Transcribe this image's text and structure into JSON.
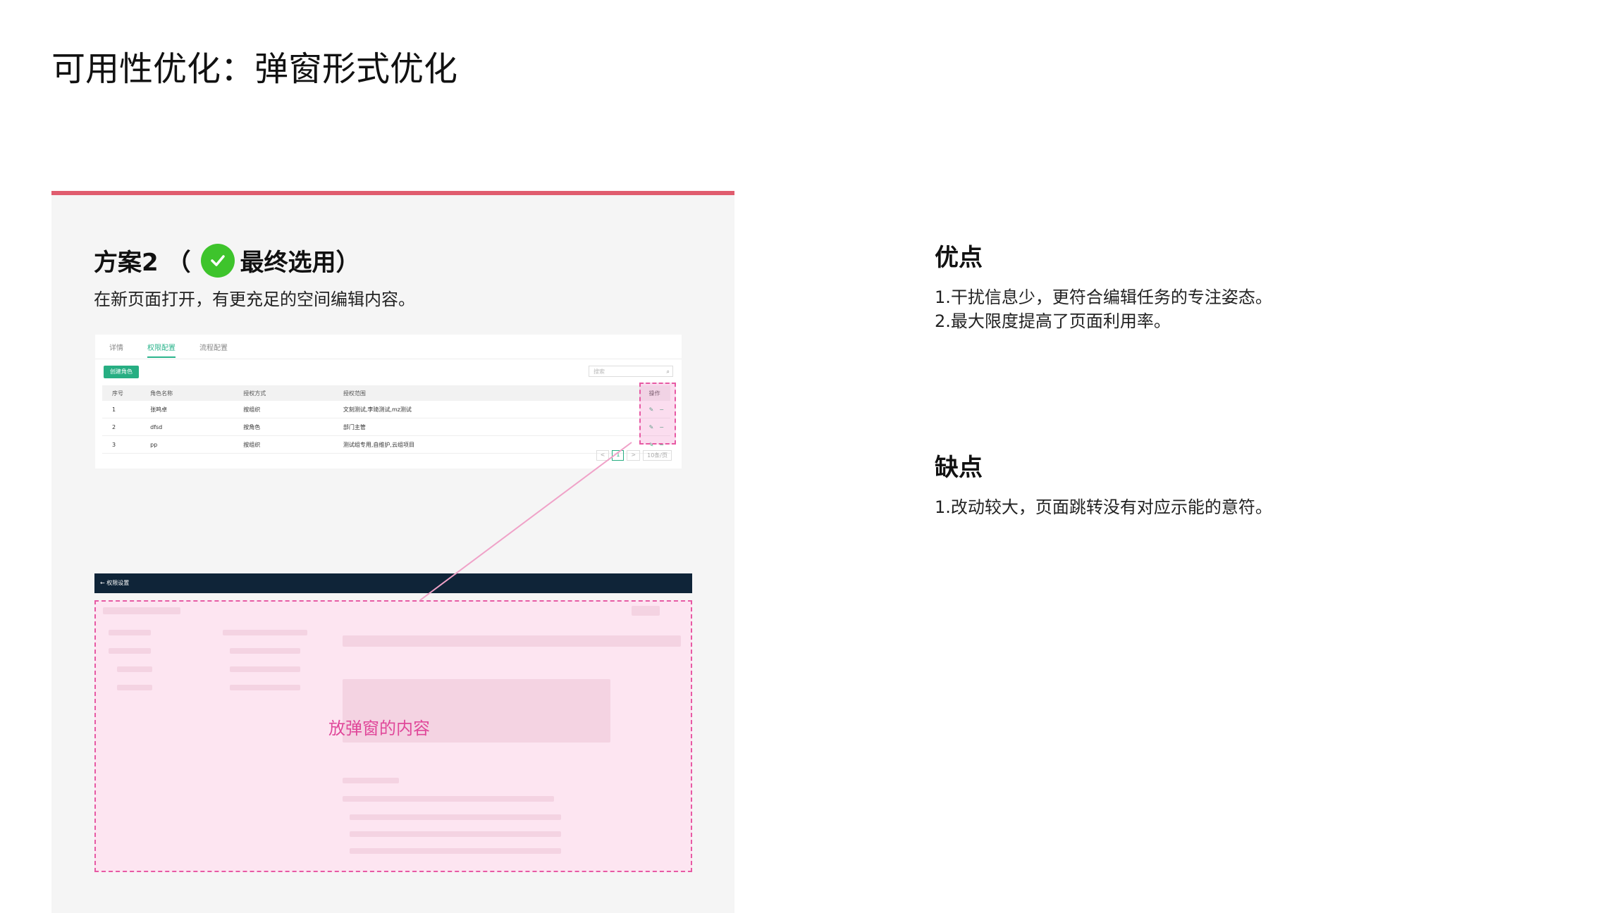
{
  "page": {
    "title": "可用性优化：弹窗形式优化"
  },
  "card": {
    "title_prefix": "方案2 （",
    "title_suffix": "最终选用）",
    "description": "在新页面打开，有更充足的空间编辑内容。",
    "accent_color": "#e05c6e",
    "check_color": "#3ec42c"
  },
  "screenshot1": {
    "tabs": [
      "详情",
      "权限配置",
      "流程配置"
    ],
    "active_tab": 1,
    "create_button": "创建角色",
    "search_placeholder": "搜索",
    "columns": [
      "序号",
      "角色名称",
      "授权方式",
      "授权范围",
      "操作"
    ],
    "rows": [
      [
        "1",
        "张鸣卓",
        "按组织",
        "文刻测试,李琦测试,mz测试"
      ],
      [
        "2",
        "dfsd",
        "按角色",
        "部门主管"
      ],
      [
        "3",
        "pp",
        "按组织",
        "测试组专用,自维护,云组项目"
      ]
    ],
    "pager": [
      "<",
      "1",
      ">",
      "10条/页"
    ]
  },
  "screenshot2": {
    "topbar_title": "← 权限设置",
    "placeholder_text": "放弹窗的内容"
  },
  "pros": {
    "title": "优点",
    "items": [
      "1.干扰信息少，更符合编辑任务的专注姿态。",
      "2.最大限度提高了页面利用率。"
    ]
  },
  "cons": {
    "title": "缺点",
    "items": [
      "1.改动较大，页面跳转没有对应示能的意符。"
    ]
  }
}
